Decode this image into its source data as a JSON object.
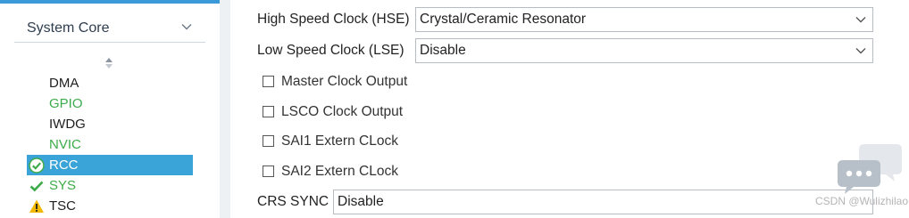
{
  "sidebar": {
    "category": "System Core",
    "items": [
      {
        "label": "DMA",
        "color": "#1f1f1f",
        "icon": ""
      },
      {
        "label": "GPIO",
        "color": "#3dab4a",
        "icon": ""
      },
      {
        "label": "IWDG",
        "color": "#1f1f1f",
        "icon": ""
      },
      {
        "label": "NVIC",
        "color": "#3dab4a",
        "icon": ""
      },
      {
        "label": "RCC",
        "color": "#ffffff",
        "icon": "check-circle-icon",
        "selected": true
      },
      {
        "label": "SYS",
        "color": "#3dab4a",
        "icon": "check-icon"
      },
      {
        "label": "TSC",
        "color": "#1f1f1f",
        "icon": "warning-icon"
      }
    ]
  },
  "config": {
    "hse": {
      "label": "High Speed Clock (HSE)",
      "value": "Crystal/Ceramic Resonator"
    },
    "lse": {
      "label": "Low Speed Clock (LSE)",
      "value": "Disable"
    },
    "checkboxes": [
      {
        "label": "Master Clock Output",
        "checked": false
      },
      {
        "label": "LSCO Clock Output",
        "checked": false
      },
      {
        "label": "SAI1 Extern CLock",
        "checked": false
      },
      {
        "label": "SAI2 Extern CLock",
        "checked": false
      }
    ],
    "crs": {
      "label": "CRS SYNC",
      "value": "Disable"
    }
  },
  "watermark": {
    "text": "CSDN @Wulizhilao"
  },
  "colors": {
    "accent": "#3aa4d8",
    "ok_green": "#3dab4a",
    "warning": "#f5b800"
  }
}
